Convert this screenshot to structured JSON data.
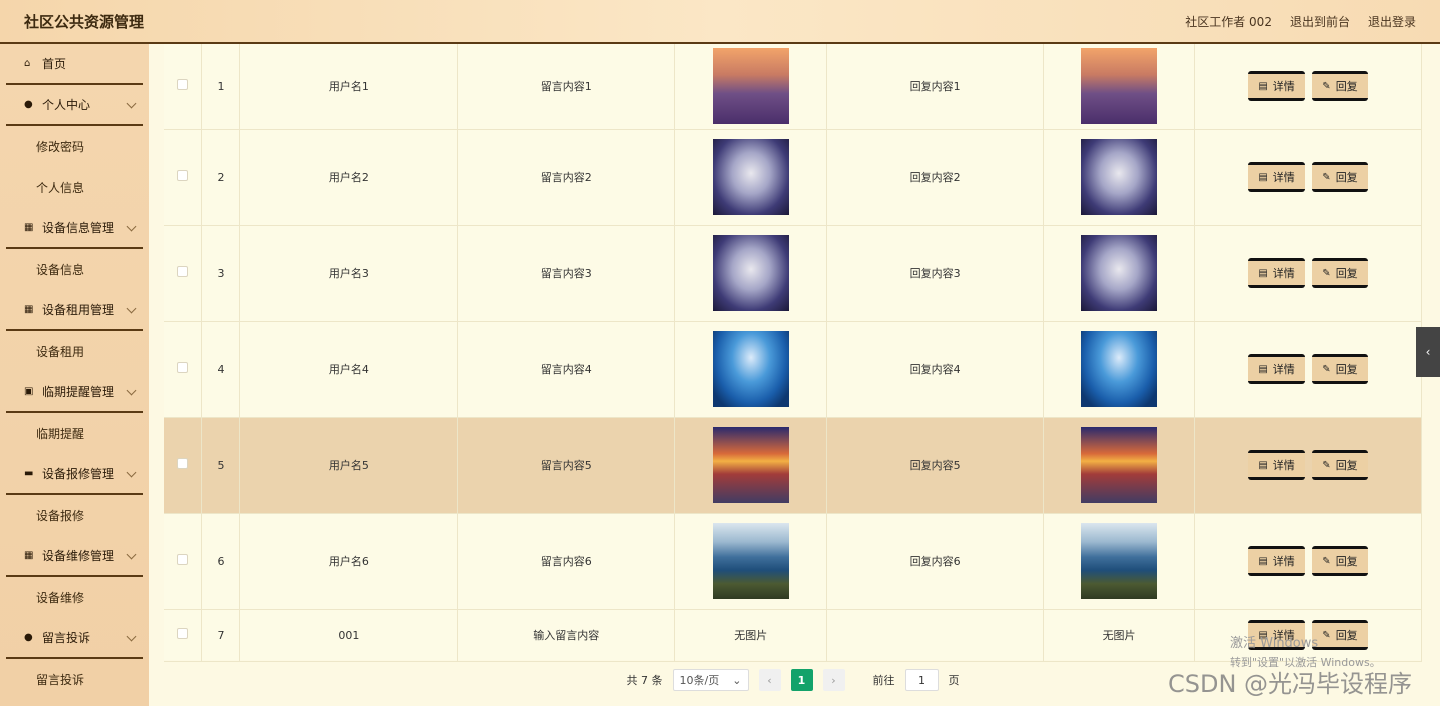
{
  "header": {
    "title": "社区公共资源管理",
    "user": "社区工作者 002",
    "front": "退出到前台",
    "logout": "退出登录"
  },
  "sidebar": {
    "home": "首页",
    "groups": [
      {
        "label": "个人中心",
        "subs": [
          "修改密码",
          "个人信息"
        ]
      },
      {
        "label": "设备信息管理",
        "subs": [
          "设备信息"
        ]
      },
      {
        "label": "设备租用管理",
        "subs": [
          "设备租用"
        ]
      },
      {
        "label": "临期提醒管理",
        "subs": [
          "临期提醒"
        ]
      },
      {
        "label": "设备报修管理",
        "subs": [
          "设备报修"
        ]
      },
      {
        "label": "设备维修管理",
        "subs": [
          "设备维修"
        ]
      },
      {
        "label": "留言投诉",
        "subs": [
          "留言投诉"
        ]
      }
    ]
  },
  "table": {
    "rows": [
      {
        "index": "1",
        "user": "用户名1",
        "content": "留言内容1",
        "reply": "回复内容1"
      },
      {
        "index": "2",
        "user": "用户名2",
        "content": "留言内容2",
        "reply": "回复内容2"
      },
      {
        "index": "3",
        "user": "用户名3",
        "content": "留言内容3",
        "reply": "回复内容3"
      },
      {
        "index": "4",
        "user": "用户名4",
        "content": "留言内容4",
        "reply": "回复内容4"
      },
      {
        "index": "5",
        "user": "用户名5",
        "content": "留言内容5",
        "reply": "回复内容5"
      },
      {
        "index": "6",
        "user": "用户名6",
        "content": "留言内容6",
        "reply": "回复内容6"
      },
      {
        "index": "7",
        "user": "001",
        "content": "输入留言内容",
        "image_text": "无图片",
        "reply": "",
        "reply_image_text": "无图片"
      }
    ],
    "detail_label": "详情",
    "reply_label": "回复"
  },
  "pager": {
    "total": "共 7 条",
    "page_size": "10条/页",
    "current": "1",
    "goto_label": "前往",
    "goto_value": "1",
    "page_unit": "页"
  },
  "watermarks": {
    "win1": "激活 Windows",
    "win2": "转到\"设置\"以激活 Windows。",
    "csdn": "CSDN @光冯毕设程序"
  }
}
